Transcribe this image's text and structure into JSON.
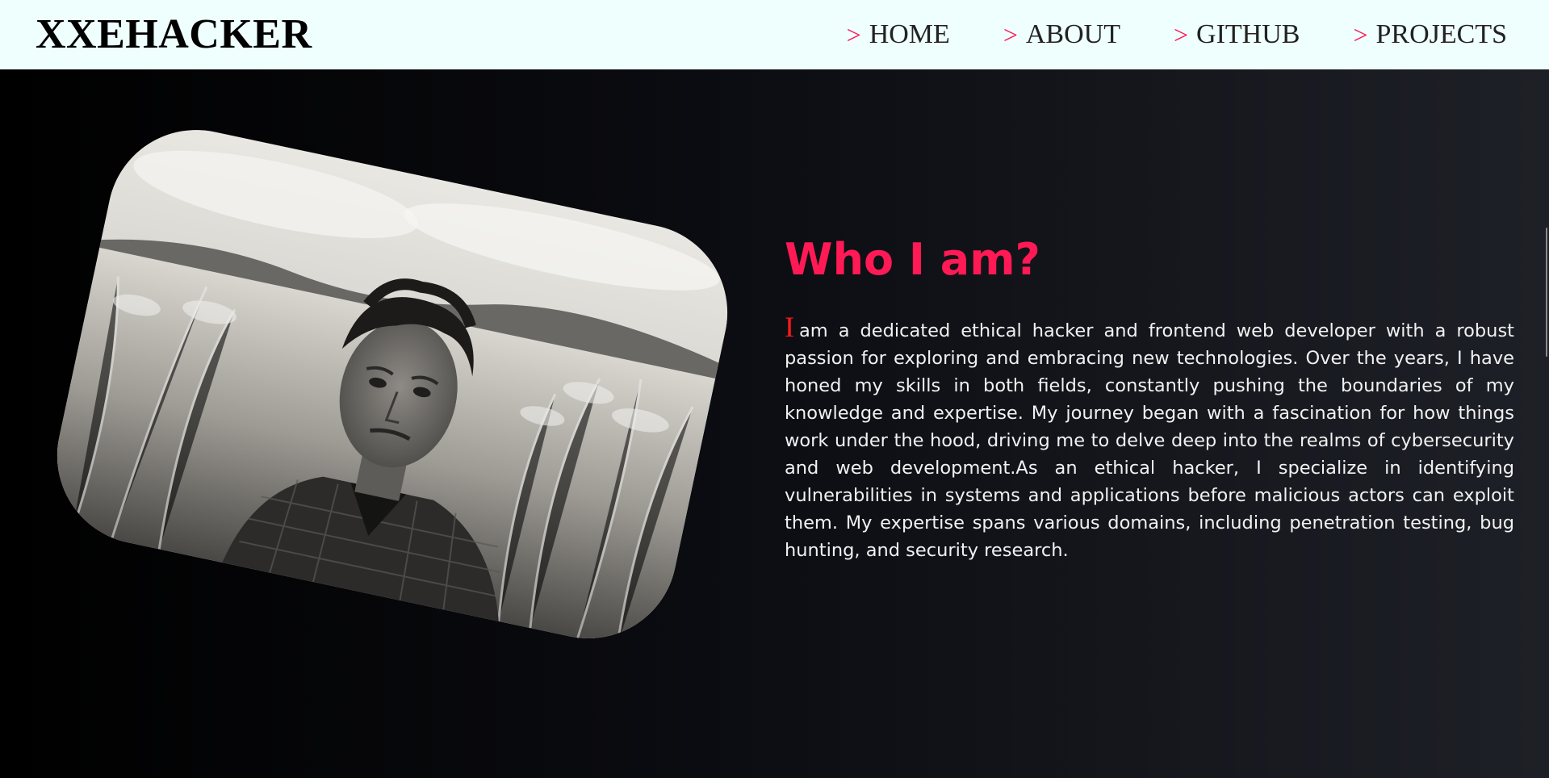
{
  "brand": {
    "title": "XXEHACKER"
  },
  "nav": {
    "arrow": ">",
    "items": [
      {
        "label": "HOME"
      },
      {
        "label": "ABOUT"
      },
      {
        "label": "GITHUB"
      },
      {
        "label": "PROJECTS"
      }
    ]
  },
  "about": {
    "title": "Who I am?",
    "dropcap": "I",
    "text": "am a dedicated ethical hacker and frontend web developer with a robust passion for exploring and embracing new technologies. Over the years, I have honed my skills in both fields, constantly pushing the boundaries of my knowledge and expertise. My journey began with a fascination for how things work under the hood, driving me to delve deep into the realms of cybersecurity and web development.As an ethical hacker, I specialize in identifying vulnerabilities in systems and applications before malicious actors can exploit them. My expertise spans various domains, including penetration testing, bug hunting, and security research."
  },
  "colors": {
    "accent": "#ff1a55",
    "navbar_bg": "#effffe",
    "dropcap": "#ff1a1a"
  }
}
